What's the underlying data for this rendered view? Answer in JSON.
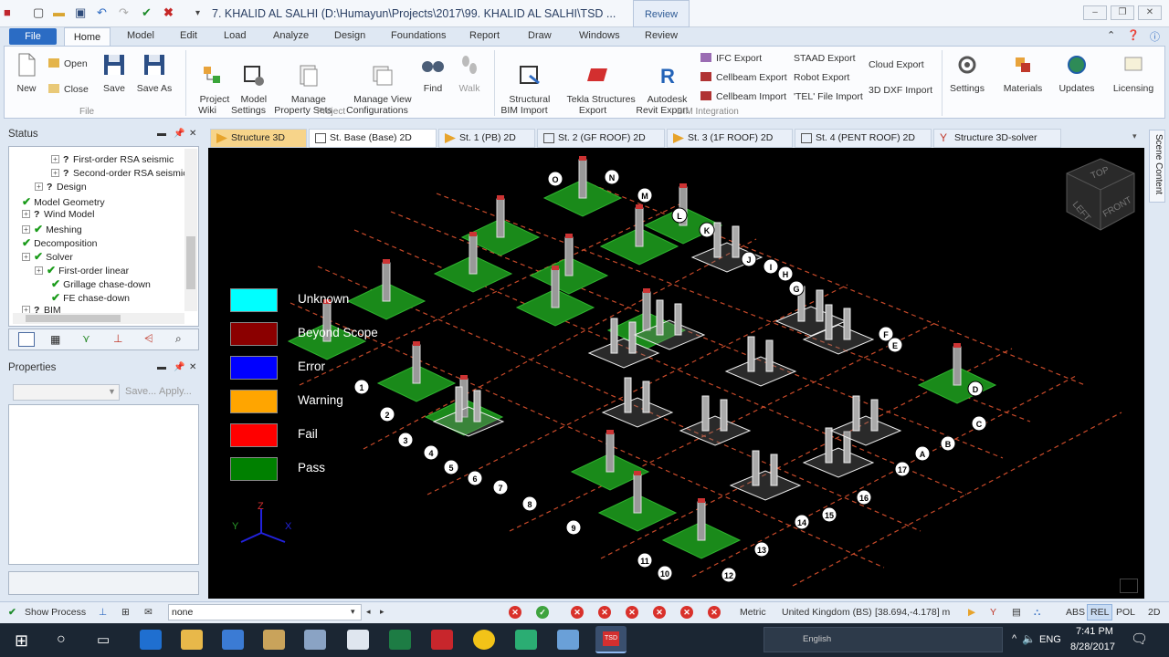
{
  "titlebar": {
    "title": "7. KHALID AL SALHI (D:\\Humayun\\Projects\\2017\\99. KHALID AL SALHI\\TSD ...",
    "context_tab": "Review"
  },
  "ribbon_tabs": [
    "File",
    "Home",
    "Model",
    "Edit",
    "Load",
    "Analyze",
    "Design",
    "Foundations",
    "Report",
    "Draw",
    "Windows",
    "Review"
  ],
  "ribbon": {
    "file": {
      "new": "New",
      "open": "Open",
      "close": "Close",
      "save": "Save",
      "save_as": "Save As",
      "group": "File"
    },
    "project": {
      "wiki": "Project\nWiki",
      "settings": "Model\nSettings",
      "property_sets": "Manage\nProperty Sets",
      "view_configs": "Manage View\nConfigurations",
      "find": "Find",
      "walk": "Walk",
      "group": "Project"
    },
    "bim": {
      "structural_bim": "Structural\nBIM Import",
      "tekla": "Tekla Structures\nExport",
      "revit": "Autodesk\nRevit Export",
      "ifc": "IFC Export",
      "cellbeam_export": "Cellbeam Export",
      "cellbeam_import": "Cellbeam Import",
      "staad": "STAAD Export",
      "robot": "Robot Export",
      "tel": "'TEL' File Import",
      "cloud": "Cloud Export",
      "dxf": "3D DXF Import",
      "group": "BIM Integration"
    },
    "settings": "Settings",
    "materials": "Materials",
    "updates": "Updates",
    "licensing": "Licensing"
  },
  "status_panel": {
    "title": "Status",
    "items": [
      {
        "label": "First-order RSA seismic",
        "icon": "pin"
      },
      {
        "label": "Second-order RSA seismic",
        "icon": "pin"
      },
      {
        "label": "Design",
        "icon": "pin"
      },
      {
        "label": "Model Geometry",
        "icon": "check"
      },
      {
        "label": "Wind Model",
        "icon": "pin"
      },
      {
        "label": "Meshing",
        "icon": "check"
      },
      {
        "label": "Decomposition",
        "icon": "check"
      },
      {
        "label": "Solver",
        "icon": "check"
      },
      {
        "label": "First-order linear",
        "icon": "check"
      },
      {
        "label": "Grillage chase-down",
        "icon": "check"
      },
      {
        "label": "FE chase-down",
        "icon": "check"
      },
      {
        "label": "BIM",
        "icon": "pin"
      }
    ]
  },
  "properties_panel": {
    "title": "Properties",
    "save": "Save...",
    "apply": "Apply..."
  },
  "doc_tabs": [
    "Structure 3D",
    "St. Base (Base) 2D",
    "St. 1 (PB) 2D",
    "St. 2 (GF ROOF) 2D",
    "St. 3 (1F ROOF) 2D",
    "St. 4 (PENT ROOF) 2D",
    "Structure 3D-solver"
  ],
  "side_panel_label": "Scene Content",
  "viewcube": {
    "top": "TOP",
    "left": "LEFT",
    "front": "FRONT"
  },
  "legend": [
    {
      "label": "Unknown",
      "color": "#00ffff"
    },
    {
      "label": "Beyond Scope",
      "color": "#8b0000"
    },
    {
      "label": "Error",
      "color": "#0000ff"
    },
    {
      "label": "Warning",
      "color": "#ffa500"
    },
    {
      "label": "Fail",
      "color": "#ff0000"
    },
    {
      "label": "Pass",
      "color": "#008000"
    }
  ],
  "axes": {
    "z": "Z",
    "y": "Y",
    "x": "X"
  },
  "grid_labels": [
    "O",
    "N",
    "M",
    "L",
    "K",
    "J",
    "I",
    "H",
    "G",
    "F",
    "E",
    "D",
    "C",
    "B",
    "A",
    "17",
    "16",
    "15",
    "14",
    "13",
    "12",
    "11",
    "10",
    "9",
    "8",
    "7",
    "6",
    "5",
    "4",
    "3",
    "2",
    "1"
  ],
  "statusbar": {
    "show_process": "Show Process",
    "combo": "none",
    "units": "Metric",
    "region": "United Kingdom (BS)",
    "coords": "[38.694,-4.178] m",
    "abs": "ABS",
    "rel": "REL",
    "pol": "POL",
    "mode": "2D"
  },
  "taskbar": {
    "language": "ENG",
    "input": "English",
    "time": "7:41 PM",
    "date": "8/28/2017",
    "app": "TSD"
  }
}
